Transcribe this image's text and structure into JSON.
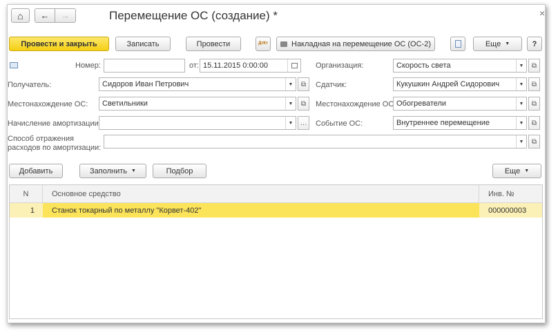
{
  "window": {
    "title": "Перемещение ОС (создание) *",
    "close_glyph": "×"
  },
  "nav": {
    "home_glyph": "⌂",
    "back_glyph": "←",
    "forward_glyph": "→"
  },
  "toolbar": {
    "post_close_label": "Провести и закрыть",
    "save_label": "Записать",
    "post_label": "Провести",
    "dtkt_label": "ДтКт",
    "print_label": "Накладная на перемещение ОС (ОС-2)",
    "more_label": "Еще",
    "help_label": "?"
  },
  "form": {
    "number_label": "Номер:",
    "number_value": "",
    "date_label": "от:",
    "date_value": "15.11.2015  0:00:00",
    "org_label": "Организация:",
    "org_value": "Скорость света",
    "recipient_label": "Получатель:",
    "recipient_value": "Сидоров Иван Петрович",
    "sender_label": "Сдатчик:",
    "sender_value": "Кукушкин Андрей Сидорович",
    "location_label": "Местонахождение ОС:",
    "location_value": "Светильники",
    "location2_label": "Местонахождение ОС:",
    "location2_value": "Обогреватели",
    "amort_label": "Начисление амортизации:",
    "amort_value": "",
    "event_label": "Событие ОС:",
    "event_value": "Внутреннее перемещение",
    "method_label_1": "Способ отражения",
    "method_label_2": "расходов по амортизации:",
    "method_value": ""
  },
  "table_toolbar": {
    "add_label": "Добавить",
    "fill_label": "Заполнить",
    "select_label": "Подбор",
    "more_label": "Еще"
  },
  "table": {
    "columns": [
      "N",
      "Основное средство",
      "Инв. №"
    ],
    "rows": [
      {
        "n": "1",
        "asset": "Станок токарный по металлу \"Корвет-402\"",
        "inv": "000000003"
      }
    ]
  },
  "colors": {
    "accent_yellow": "#f4cf14",
    "row_highlight": "#fbe45a"
  }
}
